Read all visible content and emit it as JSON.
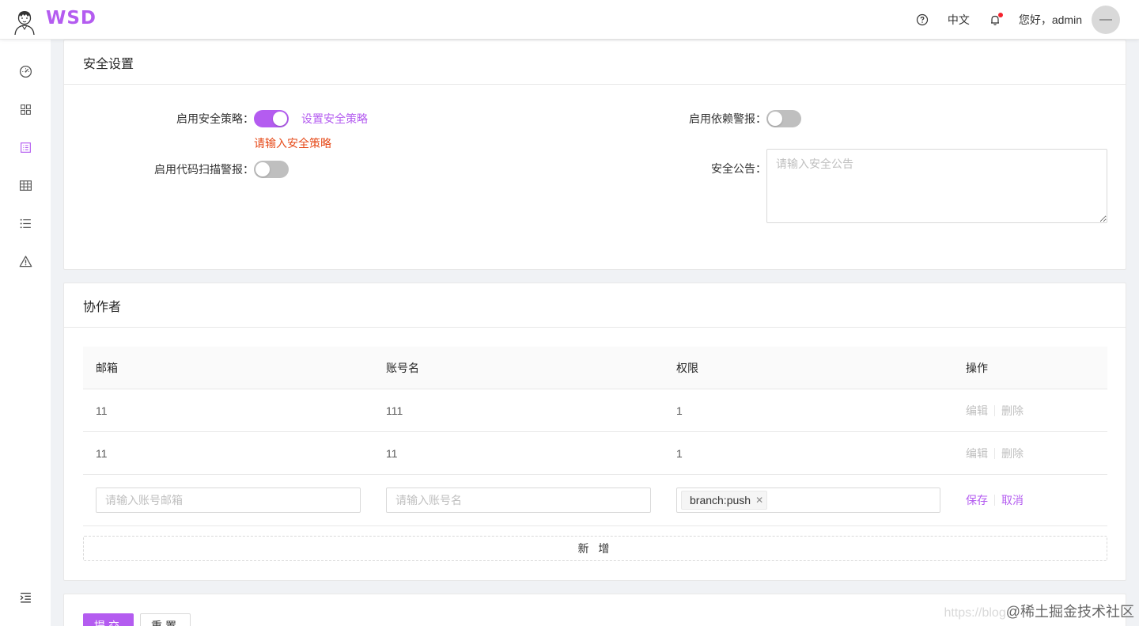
{
  "header": {
    "logo_text": "WSD",
    "lang": "中文",
    "greeting": "您好，admin"
  },
  "sidebar": {
    "items": [
      {
        "icon": "dashboard-icon"
      },
      {
        "icon": "grid-icon"
      },
      {
        "icon": "form-icon",
        "active": true
      },
      {
        "icon": "table-icon"
      },
      {
        "icon": "list-icon"
      },
      {
        "icon": "warning-icon"
      }
    ],
    "collapse_icon": "menu-fold-icon"
  },
  "security": {
    "title": "安全设置",
    "policy_label": "启用安全策略：",
    "policy_link": "设置安全策略",
    "policy_error": "请输入安全策略",
    "policy_on": true,
    "scan_label": "启用代码扫描警报：",
    "scan_on": false,
    "dep_label": "启用依赖警报：",
    "dep_on": false,
    "announce_label": "安全公告：",
    "announce_placeholder": "请输入安全公告"
  },
  "collaborators": {
    "title": "协作者",
    "columns": [
      "邮箱",
      "账号名",
      "权限",
      "操作"
    ],
    "rows": [
      {
        "email": "11",
        "account": "111",
        "perm": "1",
        "edit": "编辑",
        "delete": "删除"
      },
      {
        "email": "11",
        "account": "11",
        "perm": "1",
        "edit": "编辑",
        "delete": "删除"
      }
    ],
    "edit_row": {
      "email_placeholder": "请输入账号邮箱",
      "account_placeholder": "请输入账号名",
      "tag": "branch:push",
      "save": "保存",
      "cancel": "取消"
    },
    "add_label": "新 增"
  },
  "footer": {
    "submit": "提交",
    "reset": "重置"
  },
  "watermark": {
    "url": "https://blog",
    "text": "@稀土掘金技术社区"
  },
  "colors": {
    "accent": "#b45cf0",
    "error": "#e64a19"
  }
}
